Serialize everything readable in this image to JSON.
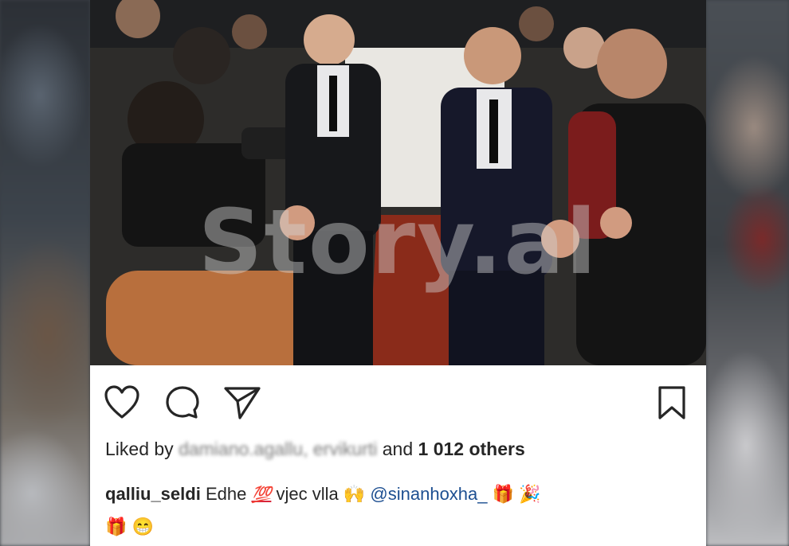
{
  "post": {
    "watermark": "Story.al",
    "likes": {
      "prefix": "Liked by",
      "blurred_users": "damiano.agallu, ervikurti",
      "conjunction": "and",
      "count_text": "1 012 others"
    },
    "caption": {
      "username": "qalliu_seldi",
      "word1": "Edhe",
      "emoji_100": "💯",
      "word2": "vjec vlla",
      "emoji_hands": "🙌",
      "mention": "@sinanhoxha_",
      "emoji_gift1": "🎁",
      "emoji_party": "🎉",
      "emoji_gift2": "🎁",
      "emoji_grin": "😁"
    }
  },
  "icons": {
    "like": "heart-icon",
    "comment": "comment-icon",
    "share": "share-icon",
    "save": "bookmark-icon"
  },
  "colors": {
    "text": "#262626",
    "mention": "#1d4f91",
    "background": "#ffffff"
  }
}
